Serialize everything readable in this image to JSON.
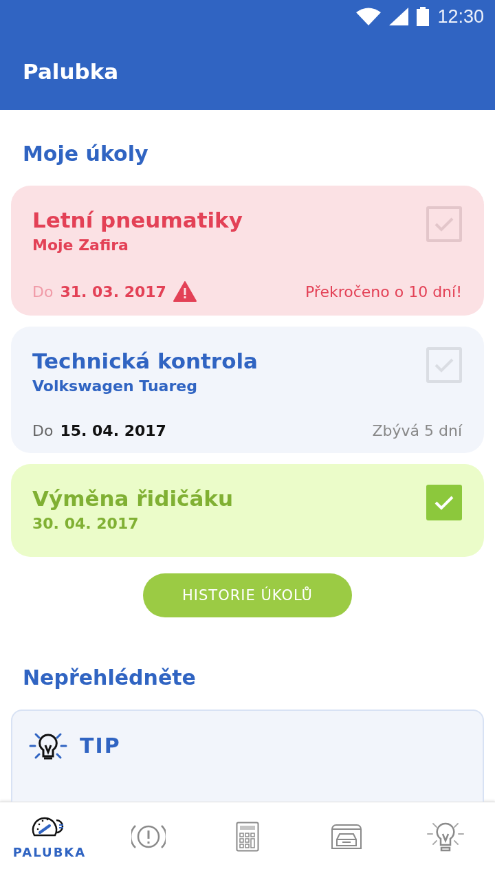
{
  "status_bar": {
    "time": "12:30"
  },
  "app_bar": {
    "title": "Palubka"
  },
  "tasks_section": {
    "title": "Moje úkoly",
    "tasks": [
      {
        "kind": "overdue",
        "title": "Letní pneumatiky",
        "subtitle": "Moje Zafira",
        "due_label": "Do",
        "due_date": "31. 03. 2017",
        "status": "Překročeno o 10 dní!",
        "checked": false
      },
      {
        "kind": "upcoming",
        "title": "Technická kontrola",
        "subtitle": "Volkswagen Tuareg",
        "due_label": "Do",
        "due_date": "15. 04. 2017",
        "status": "Zbývá 5 dní",
        "checked": false
      },
      {
        "kind": "done",
        "title": "Výměna řidičáku",
        "date": "30. 04. 2017",
        "checked": true
      }
    ],
    "history_button": "HISTORIE ÚKOLŮ"
  },
  "notice_section": {
    "title": "Nepřehlédněte",
    "tip_title": "TIP"
  },
  "bottom_nav": [
    {
      "kind": "dashboard",
      "label": "PALUBKA",
      "selected": true
    },
    {
      "kind": "alert",
      "selected": false
    },
    {
      "kind": "calculator",
      "selected": false
    },
    {
      "kind": "garage",
      "selected": false
    },
    {
      "kind": "tip",
      "selected": false
    }
  ]
}
